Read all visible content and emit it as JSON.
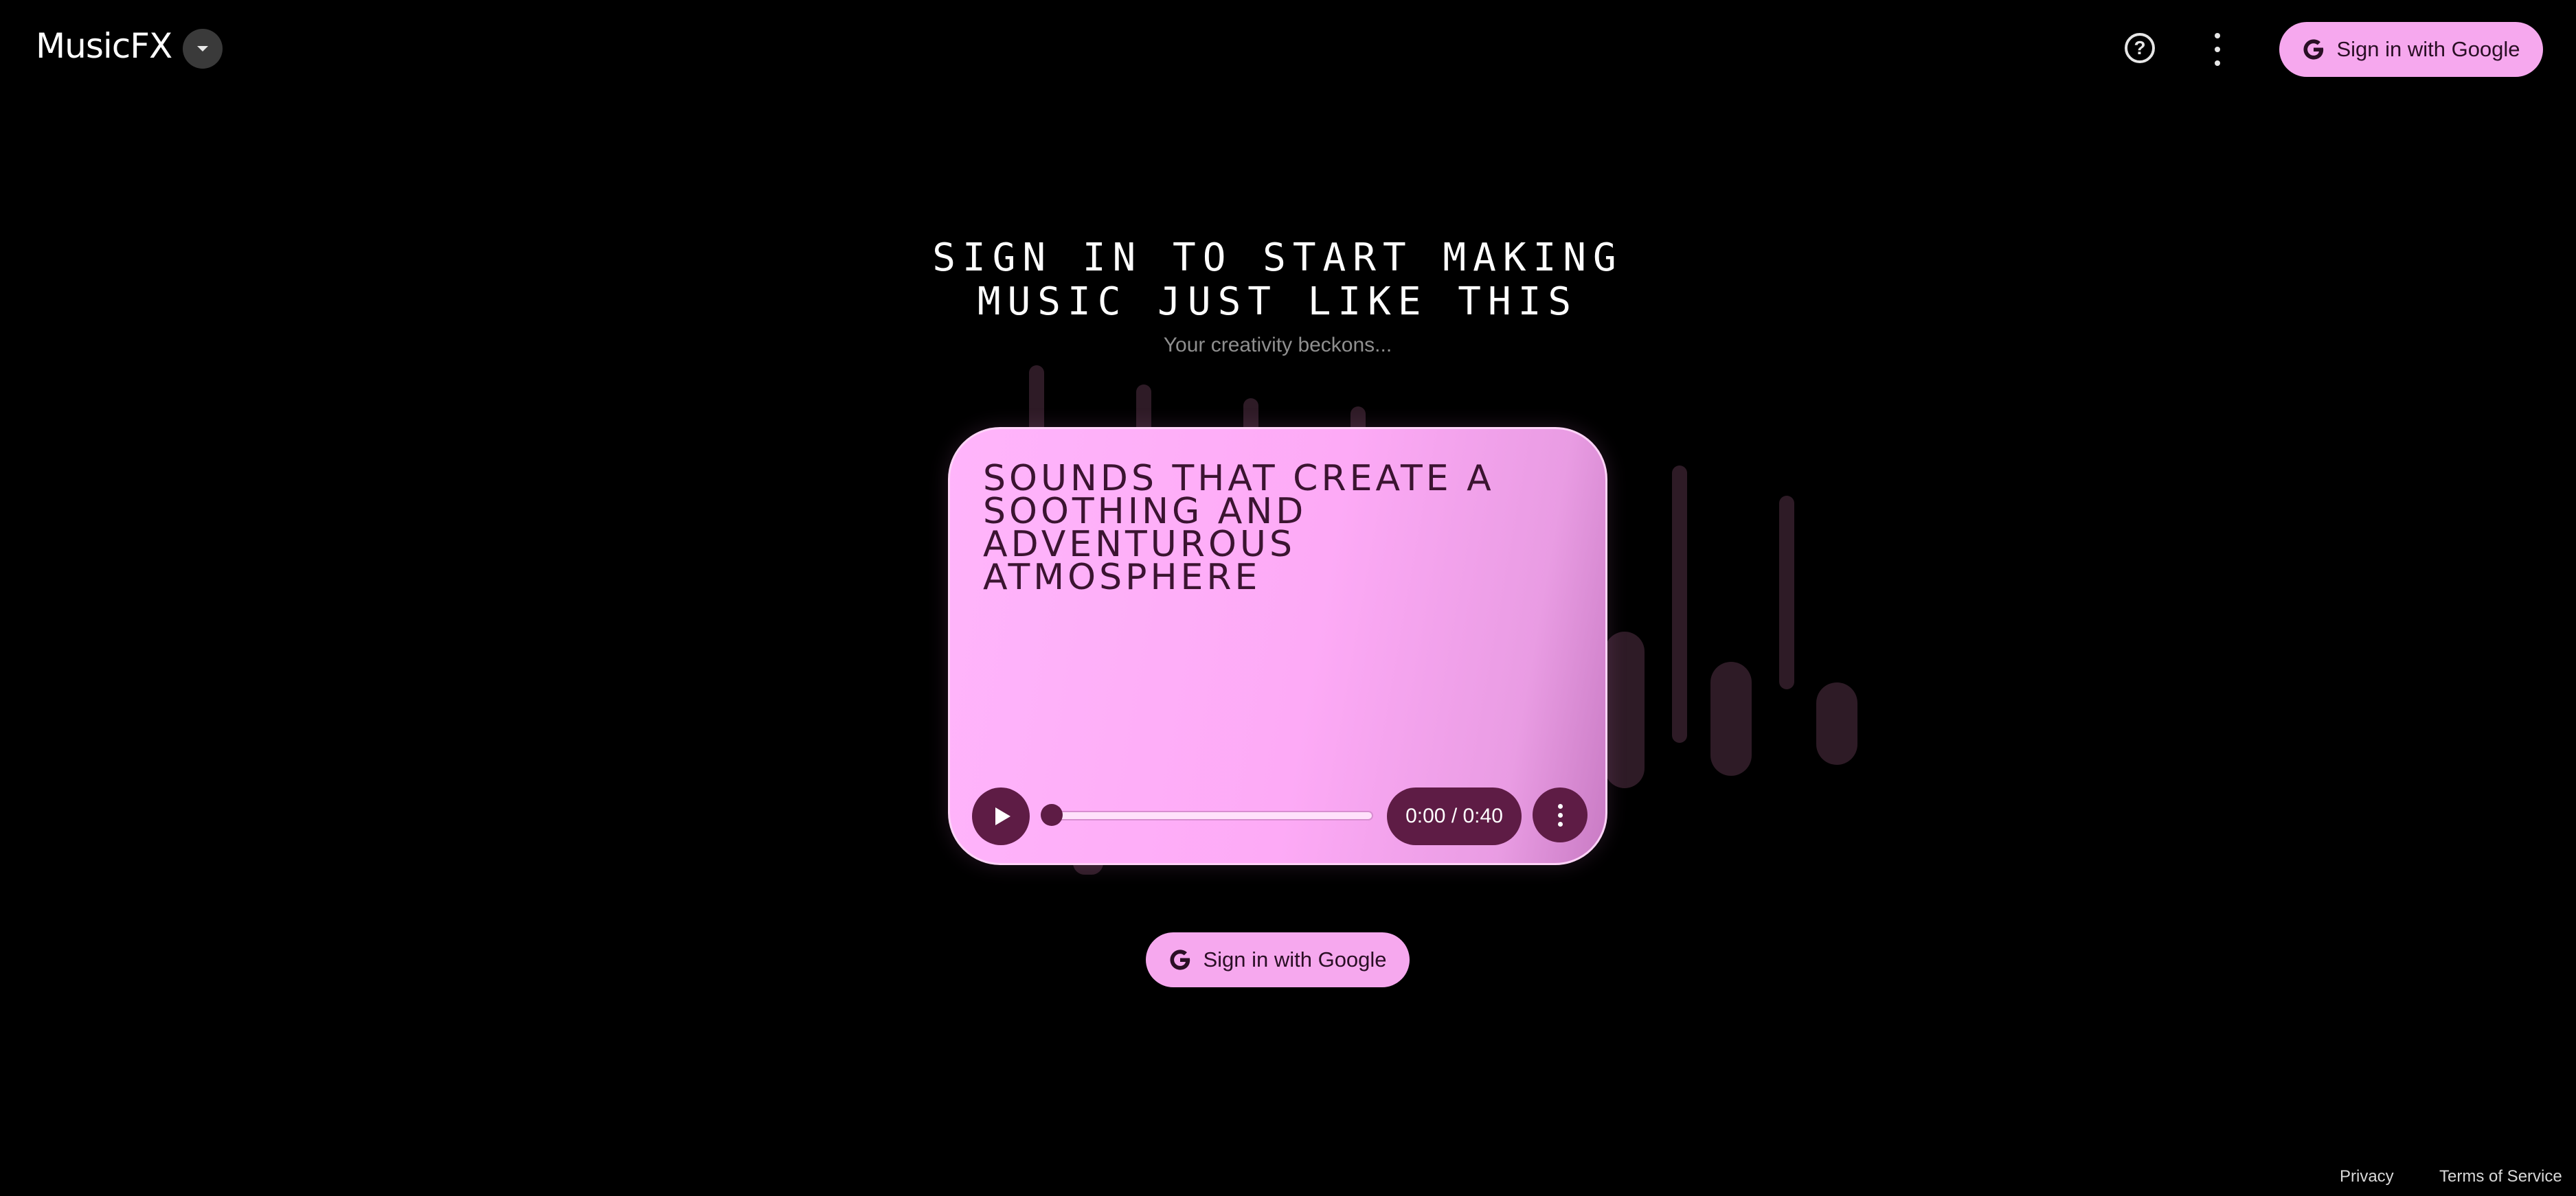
{
  "app": {
    "name": "MusicFX"
  },
  "header": {
    "product_menu_icon": "chevron-down-icon",
    "help_icon": "help-circle-icon",
    "more_icon": "more-vert-icon",
    "sign_in_label": "Sign in with Google"
  },
  "hero": {
    "headline_line1": "SIGN IN TO START MAKING",
    "headline_line2": "MUSIC JUST LIKE THIS",
    "subline": "Your creativity beckons..."
  },
  "player": {
    "prompt_line1": "SOUNDS THAT CREATE A",
    "prompt_line2": "SOOTHING AND ADVENTUROUS",
    "prompt_line3": "ATMOSPHERE",
    "time": "0:00 / 0:40",
    "progress": 0,
    "play_icon": "play-icon",
    "more_icon": "more-vert-icon"
  },
  "cta": {
    "sign_in_label": "Sign in with Google"
  },
  "footer": {
    "privacy": "Privacy",
    "terms": "Terms of Service"
  },
  "colors": {
    "background": "#000000",
    "accent_pink": "#f6a8ee",
    "card_pink": "#ffb5fb",
    "control_plum": "#5e1c45"
  }
}
